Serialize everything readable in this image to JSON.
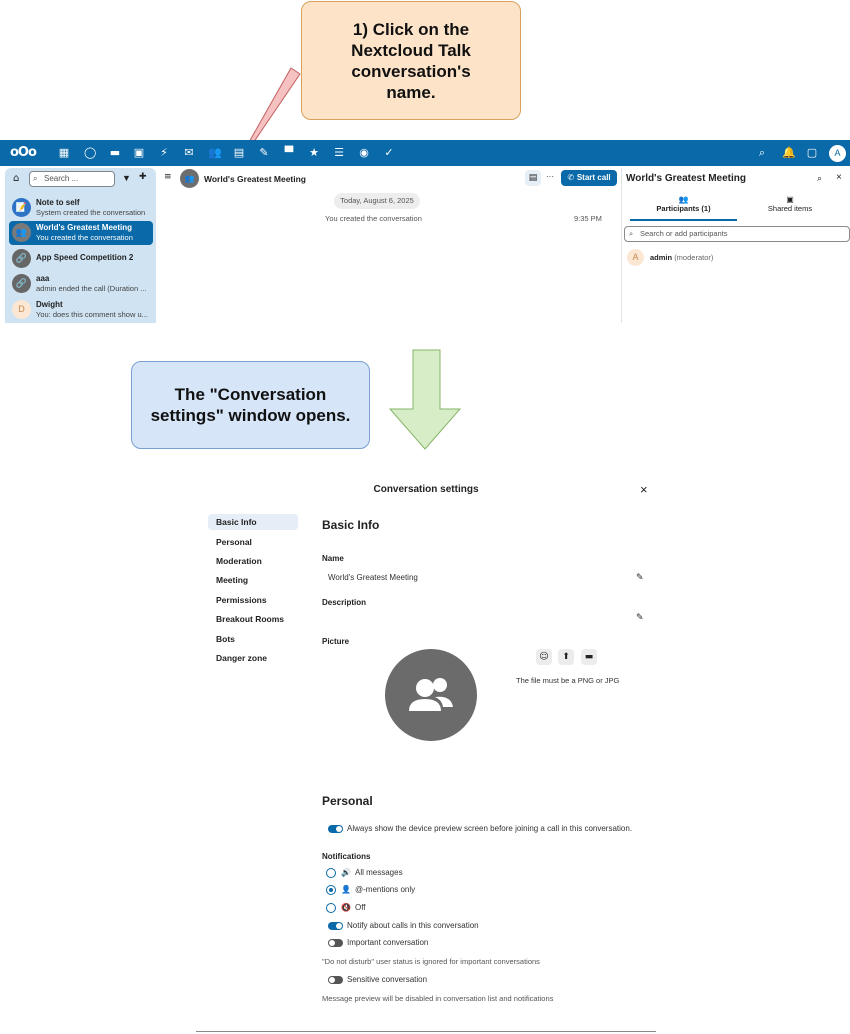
{
  "callouts": {
    "step1": "1) Click on the Nextcloud Talk conversation's name.",
    "result": "The \"Conversation settings\" window opens."
  },
  "nextcloud": {
    "search_placeholder": "Search ...",
    "conversations": [
      {
        "title": "Note to self",
        "subtitle": "System created the conversation",
        "avatar": "📝"
      },
      {
        "title": "World's Greatest Meeting",
        "subtitle": "You created the conversation",
        "avatar": "👥"
      },
      {
        "title": "App Speed Competition 2",
        "subtitle": "",
        "avatar": "🔗"
      },
      {
        "title": "aaa",
        "subtitle": "admin ended the call (Duration ...",
        "avatar": "🔗"
      },
      {
        "title": "Dwight",
        "subtitle": "You: does this comment show u...",
        "avatar": "D"
      }
    ],
    "main": {
      "title": "World's Greatest Meeting",
      "date_separator": "Today, August 6, 2025",
      "message": "You created the conversation",
      "message_time": "9:35 PM",
      "start_call": "Start call",
      "more": "···"
    },
    "sidebar": {
      "title": "World's Greatest Meeting",
      "tab_participants": "Participants (1)",
      "tab_shared": "Shared items",
      "search_placeholder": "Search or add participants",
      "participant_initial": "A",
      "participant_name": "admin",
      "participant_role": "(moderator)"
    },
    "user_initial": "A"
  },
  "dialog": {
    "title": "Conversation settings",
    "close": "×",
    "nav": [
      "Basic Info",
      "Personal",
      "Moderation",
      "Meeting",
      "Permissions",
      "Breakout Rooms",
      "Bots",
      "Danger zone"
    ],
    "basic_info": {
      "heading": "Basic Info",
      "name_label": "Name",
      "name_value": "World's Greatest Meeting",
      "description_label": "Description",
      "picture_label": "Picture",
      "picture_hint": "The file must be a PNG or JPG"
    },
    "personal": {
      "heading": "Personal",
      "device_preview": "Always show the device preview screen before joining a call in this conversation.",
      "notifications_label": "Notifications",
      "opt_all": "All messages",
      "opt_mentions": "@-mentions only",
      "opt_off": "Off",
      "notify_calls": "Notify about calls in this conversation",
      "important": "Important conversation",
      "important_hint": "\"Do not disturb\" user status is ignored for important conversations",
      "sensitive": "Sensitive conversation",
      "sensitive_hint": "Message preview will be disabled in conversation list and notifications"
    }
  }
}
